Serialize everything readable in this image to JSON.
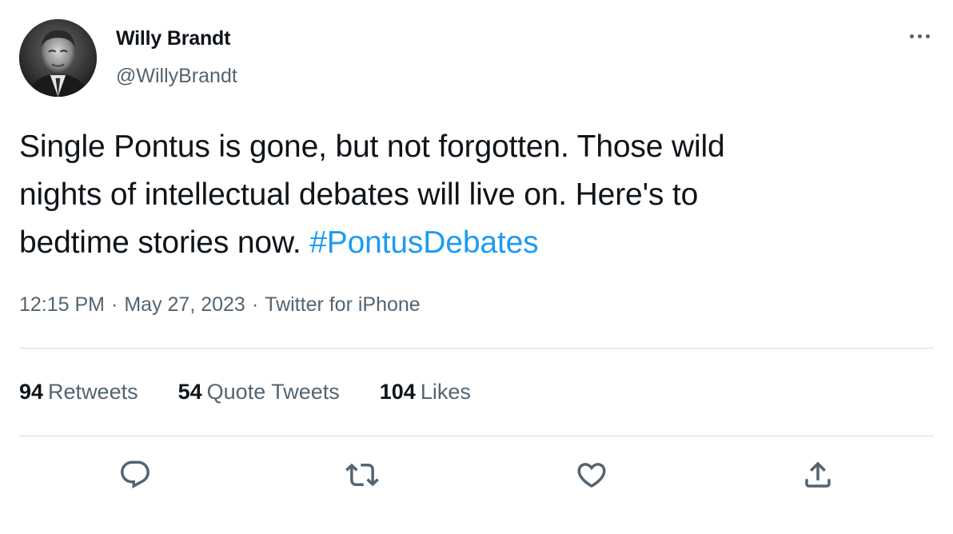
{
  "author": {
    "display_name": "Willy Brandt",
    "handle": "@WillyBrandt",
    "avatar_icon": "portrait-photo"
  },
  "more_icon": "more-dots-icon",
  "tweet": {
    "text_lines": [
      "Single Pontus is gone, but not forgotten. Those wild",
      "nights of intellectual debates will live on. Here's to",
      "bedtime stories now. "
    ],
    "hashtag": "#PontusDebates"
  },
  "meta": {
    "time": "12:15 PM",
    "date": "May 27, 2023",
    "separator": "·",
    "source": "Twitter for iPhone"
  },
  "stats": {
    "retweets": {
      "count": "94",
      "label": "Retweets"
    },
    "quote_tweets": {
      "count": "54",
      "label": "Quote Tweets"
    },
    "likes": {
      "count": "104",
      "label": "Likes"
    }
  },
  "actions": {
    "reply": "reply-icon",
    "retweet": "retweet-icon",
    "like": "heart-icon",
    "share": "share-icon"
  },
  "colors": {
    "text": "#0f1419",
    "secondary": "#536471",
    "link": "#1d9bf0",
    "divider": "#cfd9de"
  }
}
